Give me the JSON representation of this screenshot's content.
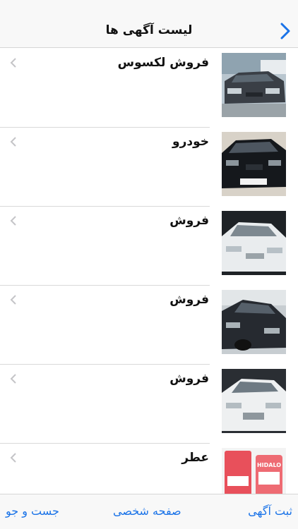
{
  "navbar": {
    "title": "لیست آگهی ها",
    "back_icon": "chevron-right-icon",
    "accent": "#1a73e8"
  },
  "listings": [
    {
      "title": "فروش لکسوس",
      "thumb": "dark-sedan-photo"
    },
    {
      "title": "خودرو",
      "thumb": "black-kia-photo"
    },
    {
      "title": "فروش",
      "thumb": "white-sedan-photo"
    },
    {
      "title": "فروش",
      "thumb": "dark-sonata-photo"
    },
    {
      "title": "فروش",
      "thumb": "white-elantra-photo"
    },
    {
      "title": "عطر",
      "thumb": "perfume-box-photo",
      "thumb_text": "HIDALO"
    }
  ],
  "tabbar": {
    "post_label": "ثبت آگهی",
    "profile_label": "صفحه شخصی",
    "search_label": "جست و جو"
  }
}
